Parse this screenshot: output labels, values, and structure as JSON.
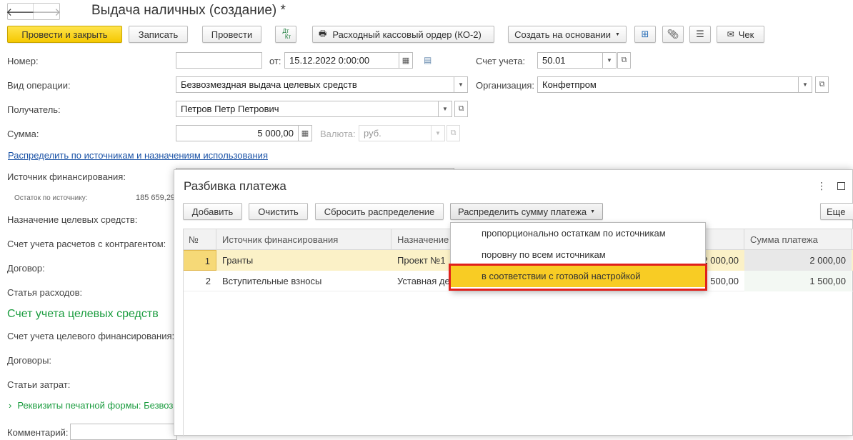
{
  "window": {
    "title": "Выдача наличных (создание) *"
  },
  "toolbar": {
    "post_close": "Провести и закрыть",
    "write": "Записать",
    "post": "Провести",
    "dt_kt_top": "Дт",
    "dt_kt_bottom": "Кт",
    "cash_order": "Расходный кассовый ордер (КО-2)",
    "create_based": "Создать на основании",
    "check": "Чек"
  },
  "form": {
    "number_label": "Номер:",
    "number_value": "",
    "from_label": "от:",
    "date_value": "15.12.2022  0:00:00",
    "account_label": "Счет учета:",
    "account_value": "50.01",
    "operation_label": "Вид операции:",
    "operation_value": "Безвозмездная выдача целевых средств",
    "organization_label": "Организация:",
    "organization_value": "Конфетпром",
    "recipient_label": "Получатель:",
    "recipient_value": "Петров Петр Петрович",
    "sum_label": "Сумма:",
    "sum_value": "5 000,00",
    "currency_label": "Валюта:",
    "currency_value": "руб.",
    "distribute_link": "Распределить по источникам и назначениям использования",
    "funding_source_label": "Источник финансирования:",
    "balance_label": "Остаток по источнику:",
    "balance_value": "185 659,29",
    "purpose_label": "Назначение целевых средств:",
    "settlement_account_label": "Счет учета расчетов с контрагентом:",
    "contract_label": "Договор:",
    "expense_item_label": "Статья расходов:",
    "section_title": "Счет учета целевых средств",
    "target_account_label": "Счет учета целевого финансирования:",
    "contracts_label": "Договоры:",
    "cost_items_label": "Статьи затрат:",
    "print_details": "Реквизиты печатной формы: Безвоз",
    "comment_label": "Комментарий:"
  },
  "modal": {
    "title": "Разбивка платежа",
    "add": "Добавить",
    "clear": "Очистить",
    "reset": "Сбросить распределение",
    "distribute": "Распределить сумму платежа",
    "more": "Еще",
    "columns": [
      "№",
      "Источник финансирования",
      "Назначение",
      "Сумма платежа"
    ],
    "rows": [
      {
        "num": "1",
        "source": "Гранты",
        "purpose": "Проект №1",
        "amount_hidden": "2 000,00",
        "amount": "2 000,00"
      },
      {
        "num": "2",
        "source": "Вступительные взносы",
        "purpose": "Уставная де",
        "amount_hidden": "1 500,00",
        "amount": "1 500,00"
      }
    ],
    "popup_items": [
      "пропорционально остаткам по источникам",
      "поровну по всем источникам",
      "в соответствии с готовой настройкой"
    ]
  },
  "colors": {
    "accent": "#f5c800",
    "highlight_border": "#e0201b",
    "section_green": "#1b9c3f"
  }
}
